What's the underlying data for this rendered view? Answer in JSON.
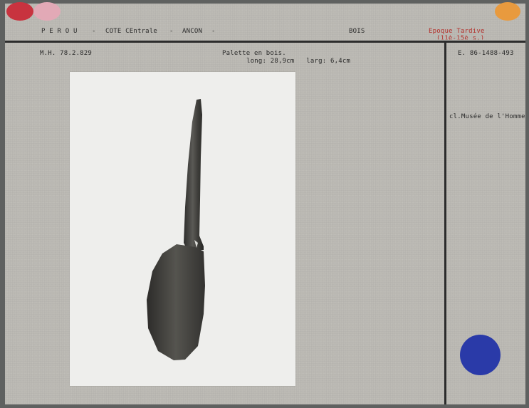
{
  "header": {
    "country": "P E R O U",
    "sep1": "-",
    "region": "COTE CEntrale",
    "sep2": "-",
    "site": "ANCON",
    "sep3": "-",
    "material": "BOIS",
    "period": "Epoque Tardive",
    "period_dates": "(11è-15è s.)"
  },
  "record": {
    "inventory_number": "M.H. 78.2.829",
    "object_title": "Palette en bois.",
    "dimensions": "long: 28,9cm   larg: 6,4cm"
  },
  "side": {
    "photo_number": "E. 86-1488-493",
    "credit": "cl.Musée de l'Homme"
  },
  "colors": {
    "card": "#bcbab4",
    "tab_red": "#c8333f",
    "tab_pink": "#e2a9b6",
    "tab_orange": "#e89a3e",
    "dot_blue": "#2a3aa8",
    "text_red": "#b3302c"
  },
  "photo": {
    "subject_icon": "wooden-paddle-photograph"
  }
}
